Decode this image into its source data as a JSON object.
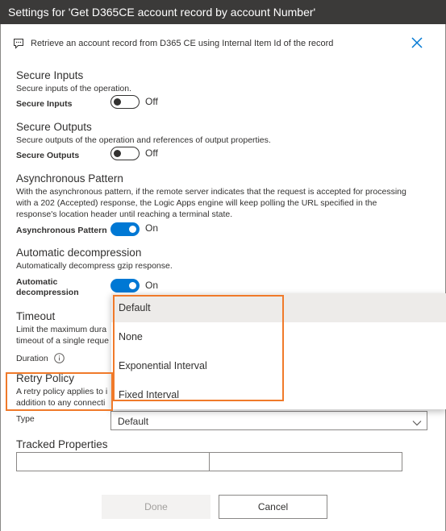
{
  "window": {
    "title": "Settings for 'Get D365CE account record by account Number'"
  },
  "header": {
    "description": "Retrieve an account record from D365 CE using Internal Item Id of the record",
    "close_icon": "close-icon",
    "comment_icon": "chat-bubble-icon"
  },
  "secure_inputs": {
    "title": "Secure Inputs",
    "description": "Secure inputs of the operation.",
    "label": "Secure Inputs",
    "toggle_state": "Off"
  },
  "secure_outputs": {
    "title": "Secure Outputs",
    "description": "Secure outputs of the operation and references of output properties.",
    "label": "Secure Outputs",
    "toggle_state": "Off"
  },
  "async_pattern": {
    "title": "Asynchronous Pattern",
    "description_lines": [
      "With the asynchronous pattern, if the remote server indicates that the request is accepted for processing",
      "with a 202 (Accepted) response, the Logic Apps engine will keep polling the URL specified in the",
      "response's location header until reaching a terminal state."
    ],
    "label": "Asynchronous Pattern",
    "toggle_state": "On"
  },
  "decompression": {
    "title": "Automatic decompression",
    "description": "Automatically decompress gzip response.",
    "label_lines": [
      "Automatic",
      "decompression"
    ],
    "toggle_state": "On"
  },
  "timeout": {
    "title": "Timeout",
    "description_lines": [
      "Limit the maximum dura",
      "timeout of a single reque"
    ],
    "label": "Duration",
    "info_icon": "info-icon"
  },
  "retry_policy": {
    "title": "Retry Policy",
    "description_lines": [
      "A retry policy applies to i",
      "addition to any connecti"
    ],
    "type_label": "Type",
    "type_value": "Default",
    "options": [
      "Default",
      "None",
      "Exponential Interval",
      "Fixed Interval"
    ],
    "selected_option": "Default"
  },
  "tracked_properties": {
    "title": "Tracked Properties",
    "key_value": "",
    "value_value": ""
  },
  "footer": {
    "done_label": "Done",
    "cancel_label": "Cancel"
  },
  "colors": {
    "titlebar": "#3b3a39",
    "toggle_on": "#0078d4",
    "highlight": "#f07a2a",
    "selected_item": "#edebe9"
  }
}
